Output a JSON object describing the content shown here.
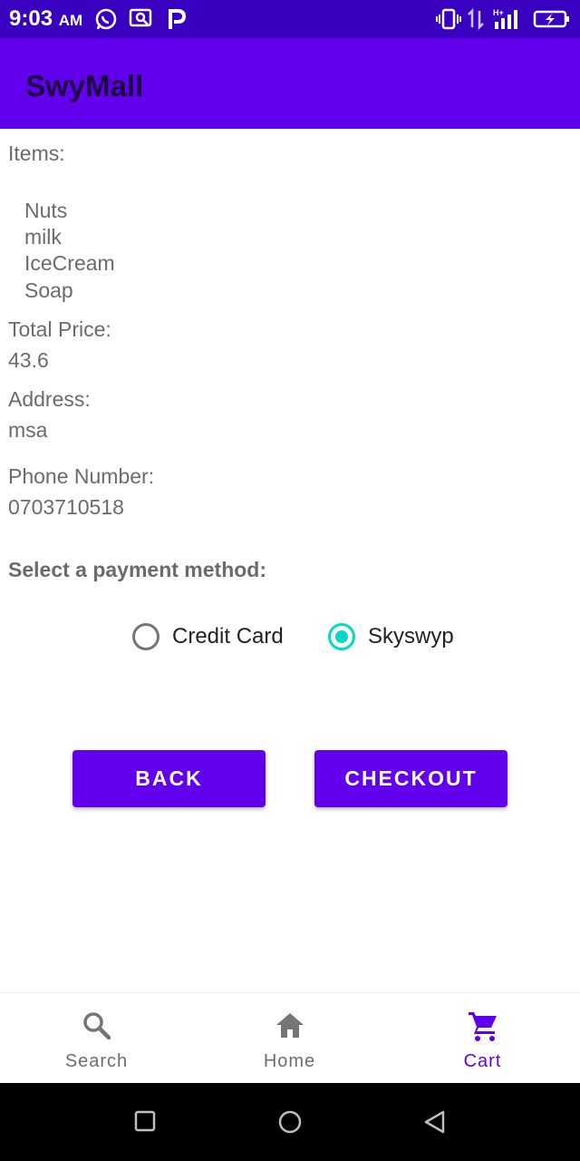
{
  "status_bar": {
    "time": "9:03",
    "ampm": "AM",
    "icons": [
      "whatsapp-icon",
      "chat-icon",
      "paypal-icon",
      "vibrate-icon",
      "data-arrows-icon",
      "hplus-signal-icon",
      "battery-charging-icon"
    ]
  },
  "app_bar": {
    "title": "SwyMall"
  },
  "order": {
    "items_label": "Items:",
    "items": [
      "Nuts",
      "milk",
      "IceCream",
      "Soap"
    ],
    "total_label": "Total Price:",
    "total_value": "43.6",
    "address_label": "Address:",
    "address_value": "msa",
    "phone_label": "Phone Number:",
    "phone_value": "0703710518"
  },
  "payment": {
    "title": "Select a payment method:",
    "options": [
      {
        "label": "Credit Card",
        "selected": false
      },
      {
        "label": "Skyswyp",
        "selected": true
      }
    ]
  },
  "buttons": {
    "back": "BACK",
    "checkout": "CHECKOUT"
  },
  "bottom_nav": {
    "items": [
      {
        "label": "Search",
        "icon": "search-icon",
        "active": false
      },
      {
        "label": "Home",
        "icon": "home-icon",
        "active": false
      },
      {
        "label": "Cart",
        "icon": "cart-icon",
        "active": true
      }
    ]
  },
  "colors": {
    "status_bar": "#3a00c0",
    "primary": "#6200ee",
    "accent": "#03dac5",
    "text_secondary": "#6b6b6b"
  }
}
